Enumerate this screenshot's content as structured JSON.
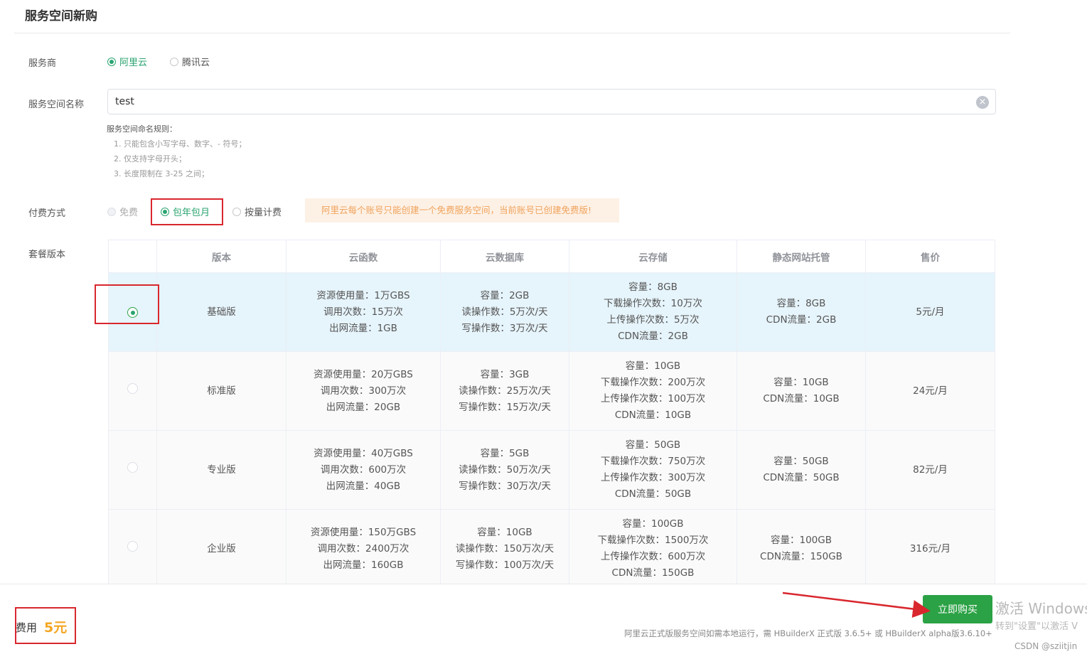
{
  "page": {
    "title": "服务空间新购"
  },
  "provider": {
    "label": "服务商",
    "options": [
      {
        "label": "阿里云",
        "checked": true
      },
      {
        "label": "腾讯云",
        "checked": false
      }
    ]
  },
  "space_name": {
    "label": "服务空间名称",
    "value": "test",
    "rules_title": "服务空间命名规则：",
    "rules": [
      "1. 只能包含小写字母、数字、- 符号；",
      "2. 仅支持字母开头；",
      "3. 长度限制在 3-25 之间；"
    ]
  },
  "payment": {
    "label": "付费方式",
    "options": [
      {
        "label": "免费",
        "checked": false
      },
      {
        "label": "包年包月",
        "checked": true
      },
      {
        "label": "按量计费",
        "checked": false
      }
    ],
    "notice": "阿里云每个账号只能创建一个免费服务空间，当前账号已创建免费版!"
  },
  "plans": {
    "label": "套餐版本",
    "headers": [
      "",
      "版本",
      "云函数",
      "云数据库",
      "云存储",
      "静态网站托管",
      "售价"
    ],
    "rows": [
      {
        "selected": true,
        "name": "基础版",
        "functions": [
          "资源使用量：1万GBS",
          "调用次数：15万次",
          "出网流量：1GB"
        ],
        "database": [
          "容量：2GB",
          "读操作数：5万次/天",
          "写操作数：3万次/天"
        ],
        "storage": [
          "容量：8GB",
          "下载操作次数：10万次",
          "上传操作次数：5万次",
          "CDN流量：2GB"
        ],
        "hosting": [
          "容量：8GB",
          "CDN流量：2GB"
        ],
        "price": "5元/月"
      },
      {
        "selected": false,
        "name": "标准版",
        "functions": [
          "资源使用量：20万GBS",
          "调用次数：300万次",
          "出网流量：20GB"
        ],
        "database": [
          "容量：3GB",
          "读操作数：25万次/天",
          "写操作数：15万次/天"
        ],
        "storage": [
          "容量：10GB",
          "下载操作次数：200万次",
          "上传操作次数：100万次",
          "CDN流量：10GB"
        ],
        "hosting": [
          "容量：10GB",
          "CDN流量：10GB"
        ],
        "price": "24元/月"
      },
      {
        "selected": false,
        "name": "专业版",
        "functions": [
          "资源使用量：40万GBS",
          "调用次数：600万次",
          "出网流量：40GB"
        ],
        "database": [
          "容量：5GB",
          "读操作数：50万次/天",
          "写操作数：30万次/天"
        ],
        "storage": [
          "容量：50GB",
          "下载操作次数：750万次",
          "上传操作次数：300万次",
          "CDN流量：50GB"
        ],
        "hosting": [
          "容量：50GB",
          "CDN流量：50GB"
        ],
        "price": "82元/月"
      },
      {
        "selected": false,
        "name": "企业版",
        "functions": [
          "资源使用量：150万GBS",
          "调用次数：2400万次",
          "出网流量：160GB"
        ],
        "database": [
          "容量：10GB",
          "读操作数：150万次/天",
          "写操作数：100万次/天"
        ],
        "storage": [
          "容量：100GB",
          "下载操作次数：1500万次",
          "上传操作次数：600万次",
          "CDN流量：150GB"
        ],
        "hosting": [
          "容量：100GB",
          "CDN流量：150GB"
        ],
        "price": "316元/月"
      }
    ]
  },
  "footer": {
    "fee_label": "费用",
    "fee_value": "5元",
    "buy_label": "立即购买",
    "note": "阿里云正式版服务空间如需本地运行，需 HBuilderX 正式版 3.6.5+ 或 HBuilderX alpha版3.6.10+"
  },
  "overlay": {
    "windows_title": "激活 Windows",
    "windows_sub": "转到\"设置\"以激活 V",
    "watermark": "CSDN @sziitjin"
  },
  "colors": {
    "accent_green": "#2ba471",
    "button_green": "#2ba245",
    "highlight_red": "#d9272e",
    "fee_orange": "#f5a623",
    "selected_row": "#e6f4fb"
  }
}
